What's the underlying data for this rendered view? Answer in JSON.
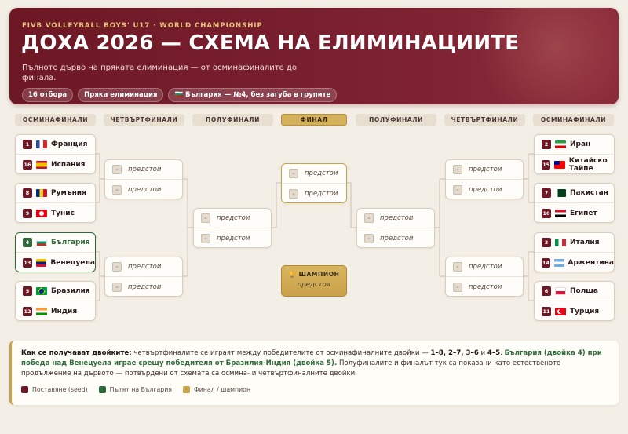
{
  "header": {
    "kicker": "FIVB VOLLEYBALL BOYS' U17 · WORLD CHAMPIONSHIP",
    "title": "ДОХА 2026 — СХЕМА НА ЕЛИМИНАЦИИТЕ",
    "subtitle": "Пълното дърво на пряката елиминация — от осминафиналите до финала.",
    "chips": [
      "16 отбора",
      "Пряка елиминация",
      "🇧🇬 България — №4, без загуба в групите"
    ]
  },
  "rounds": [
    "ОСМИНАФИНАЛИ",
    "ЧЕТВЪРТФИНАЛИ",
    "ПОЛУФИНАЛИ",
    "ФИНАЛ",
    "ПОЛУФИНАЛИ",
    "ЧЕТВЪРТФИНАЛИ",
    "ОСМИНАФИНАЛИ"
  ],
  "tbd_seed": "–",
  "tbd_label": "предстои",
  "left_r16": [
    {
      "a": {
        "seed": "1",
        "name": "Франция",
        "flag": "france"
      },
      "b": {
        "seed": "16",
        "name": "Испания",
        "flag": "spain"
      }
    },
    {
      "a": {
        "seed": "8",
        "name": "Румъния",
        "flag": "romania"
      },
      "b": {
        "seed": "9",
        "name": "Тунис",
        "flag": "tunisia"
      }
    },
    {
      "a": {
        "seed": "4",
        "name": "България",
        "flag": "bulgaria"
      },
      "b": {
        "seed": "13",
        "name": "Венецуела",
        "flag": "venezuela"
      }
    },
    {
      "a": {
        "seed": "5",
        "name": "Бразилия",
        "flag": "brazil"
      },
      "b": {
        "seed": "12",
        "name": "Индия",
        "flag": "india"
      }
    }
  ],
  "right_r16": [
    {
      "a": {
        "seed": "2",
        "name": "Иран",
        "flag": "iran"
      },
      "b": {
        "seed": "15",
        "name": "Китайско Тайпе",
        "flag": "taipei"
      }
    },
    {
      "a": {
        "seed": "7",
        "name": "Пакистан",
        "flag": "pakistan"
      },
      "b": {
        "seed": "10",
        "name": "Египет",
        "flag": "egypt"
      }
    },
    {
      "a": {
        "seed": "3",
        "name": "Италия",
        "flag": "italy"
      },
      "b": {
        "seed": "14",
        "name": "Аржентина",
        "flag": "argentina"
      }
    },
    {
      "a": {
        "seed": "6",
        "name": "Полша",
        "flag": "poland"
      },
      "b": {
        "seed": "11",
        "name": "Турция",
        "flag": "turkey"
      }
    }
  ],
  "champion": {
    "label": "ШАМПИОН",
    "icon": "trophy-icon",
    "value": "предстои"
  },
  "note": {
    "lead": "Как се получават двойките:",
    "t1": " четвъртфиналите се играят между победителите от осминафиналните двойки — ",
    "pairs": "1–8, 2–7, 3–6",
    "t2": " и ",
    "pair4": "4–5",
    "t3": ". ",
    "highlight": "България (двойка 4) при победа над Венецуела играе срещу победителя от Бразилия-Индия (двойка 5).",
    "t4": " Полуфиналите и финалът тук са показани като естественото продължение на дървото — потвърдени от схемата са осмина- и четвъртфиналните двойки."
  },
  "legend": [
    {
      "label": "Поставяне (seed)",
      "color": "#6d1825"
    },
    {
      "label": "Пътят на България",
      "color": "#2f6b3a"
    },
    {
      "label": "Финал / шампион",
      "color": "#c9a34a"
    }
  ],
  "colors": {
    "accent": "#6d1825",
    "green": "#2f6b3a",
    "gold": "#c9a34a",
    "background": "#f4efe6"
  }
}
